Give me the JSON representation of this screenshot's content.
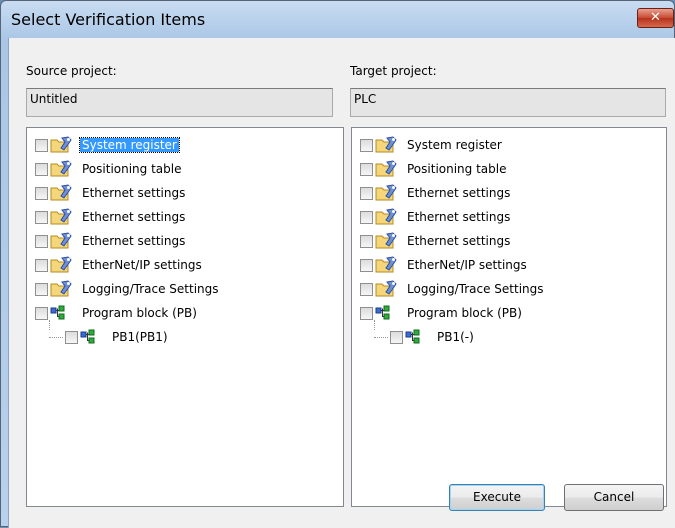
{
  "dialog": {
    "title": "Select Verification Items",
    "close_label": "✕"
  },
  "source": {
    "label": "Source project:",
    "value": "Untitled",
    "items": [
      {
        "label": "System register",
        "selected": true
      },
      {
        "label": "Positioning table"
      },
      {
        "label": "Ethernet settings"
      },
      {
        "label": "Ethernet settings"
      },
      {
        "label": "Ethernet settings"
      },
      {
        "label": "EtherNet/IP settings"
      },
      {
        "label": "Logging/Trace Settings"
      },
      {
        "label": "Program block (PB)"
      }
    ],
    "child": {
      "label": "PB1(PB1)"
    }
  },
  "target": {
    "label": "Target project:",
    "value": "PLC",
    "items": [
      {
        "label": "System register"
      },
      {
        "label": "Positioning table"
      },
      {
        "label": "Ethernet settings"
      },
      {
        "label": "Ethernet settings"
      },
      {
        "label": "Ethernet settings"
      },
      {
        "label": "EtherNet/IP settings"
      },
      {
        "label": "Logging/Trace Settings"
      },
      {
        "label": "Program block (PB)"
      }
    ],
    "child": {
      "label": "PB1(-)"
    }
  },
  "buttons": {
    "execute": "Execute",
    "cancel": "Cancel"
  },
  "icons": {
    "settings": "folder-wrench-icon",
    "program_block": "program-block-icon"
  }
}
